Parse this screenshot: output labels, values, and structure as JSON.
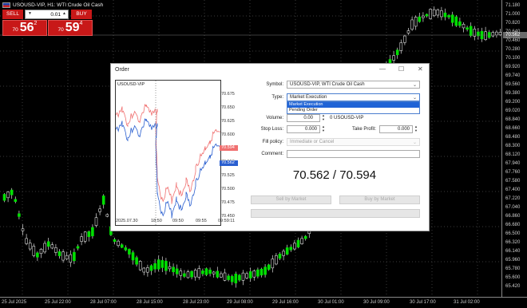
{
  "chart": {
    "title": "USOUSD-VIP, H1: WTI Crude Oil Cash",
    "price_labels": [
      "71.180",
      "71.000",
      "70.820",
      "70.640",
      "70.460",
      "70.280",
      "70.100",
      "69.920",
      "69.740",
      "69.560",
      "69.380",
      "69.200",
      "69.020",
      "68.840",
      "68.660",
      "68.480",
      "68.300",
      "68.120",
      "67.940",
      "67.760",
      "67.580",
      "67.400",
      "67.220",
      "67.040",
      "66.860",
      "66.680",
      "66.500",
      "66.320",
      "66.140",
      "65.960",
      "65.780",
      "65.600",
      "65.420"
    ],
    "current_price": "70.562",
    "time_labels": [
      "25 Jul 2025",
      "25 Jul 22:00",
      "28 Jul 07:00",
      "28 Jul 15:00",
      "28 Jul 23:00",
      "29 Jul 08:00",
      "29 Jul 16:00",
      "30 Jul 01:00",
      "30 Jul 09:00",
      "30 Jul 17:00",
      "31 Jul 02:00"
    ]
  },
  "one_click": {
    "sell_label": "SELL",
    "buy_label": "BUY",
    "volume": "0.01",
    "sell_prefix": "70",
    "sell_big": "56",
    "sell_sup": "2",
    "buy_prefix": "70",
    "buy_big": "59",
    "buy_sup": "4"
  },
  "dialog": {
    "title": "Order",
    "mini_symbol": "USOUSD-VIP",
    "mini_prices": [
      "70.675",
      "70.650",
      "70.625",
      "70.600",
      "70.575",
      "70.550",
      "70.525",
      "70.500",
      "70.475",
      "70.450"
    ],
    "ask_tag": "70.594",
    "bid_tag": "70.562",
    "mini_times": [
      "2025.07.30",
      "18:50",
      "09:50",
      "09:55",
      "09:59:11"
    ],
    "symbol_label": "Symbol:",
    "symbol_value": "USOUSD-VIP, WTI Crude Oil Cash",
    "type_label": "Type:",
    "type_value": "Market Execution",
    "type_options": [
      "Market Execution",
      "Pending Order"
    ],
    "volume_label": "Volume:",
    "volume_value": "0.00",
    "volume_unit": "0 USOUSD-VIP",
    "stoploss_label": "Stop Loss:",
    "stoploss_value": "0.000",
    "takeprofit_label": "Take Profit:",
    "takeprofit_value": "0.000",
    "fill_label": "Fill policy:",
    "fill_value": "Immediate or Cancel",
    "comment_label": "Comment:",
    "comment_value": "",
    "quote": "70.562 / 70.594",
    "sell_button": "Sell by Market",
    "buy_button": "Buy by Market",
    "bottom_button": ""
  }
}
